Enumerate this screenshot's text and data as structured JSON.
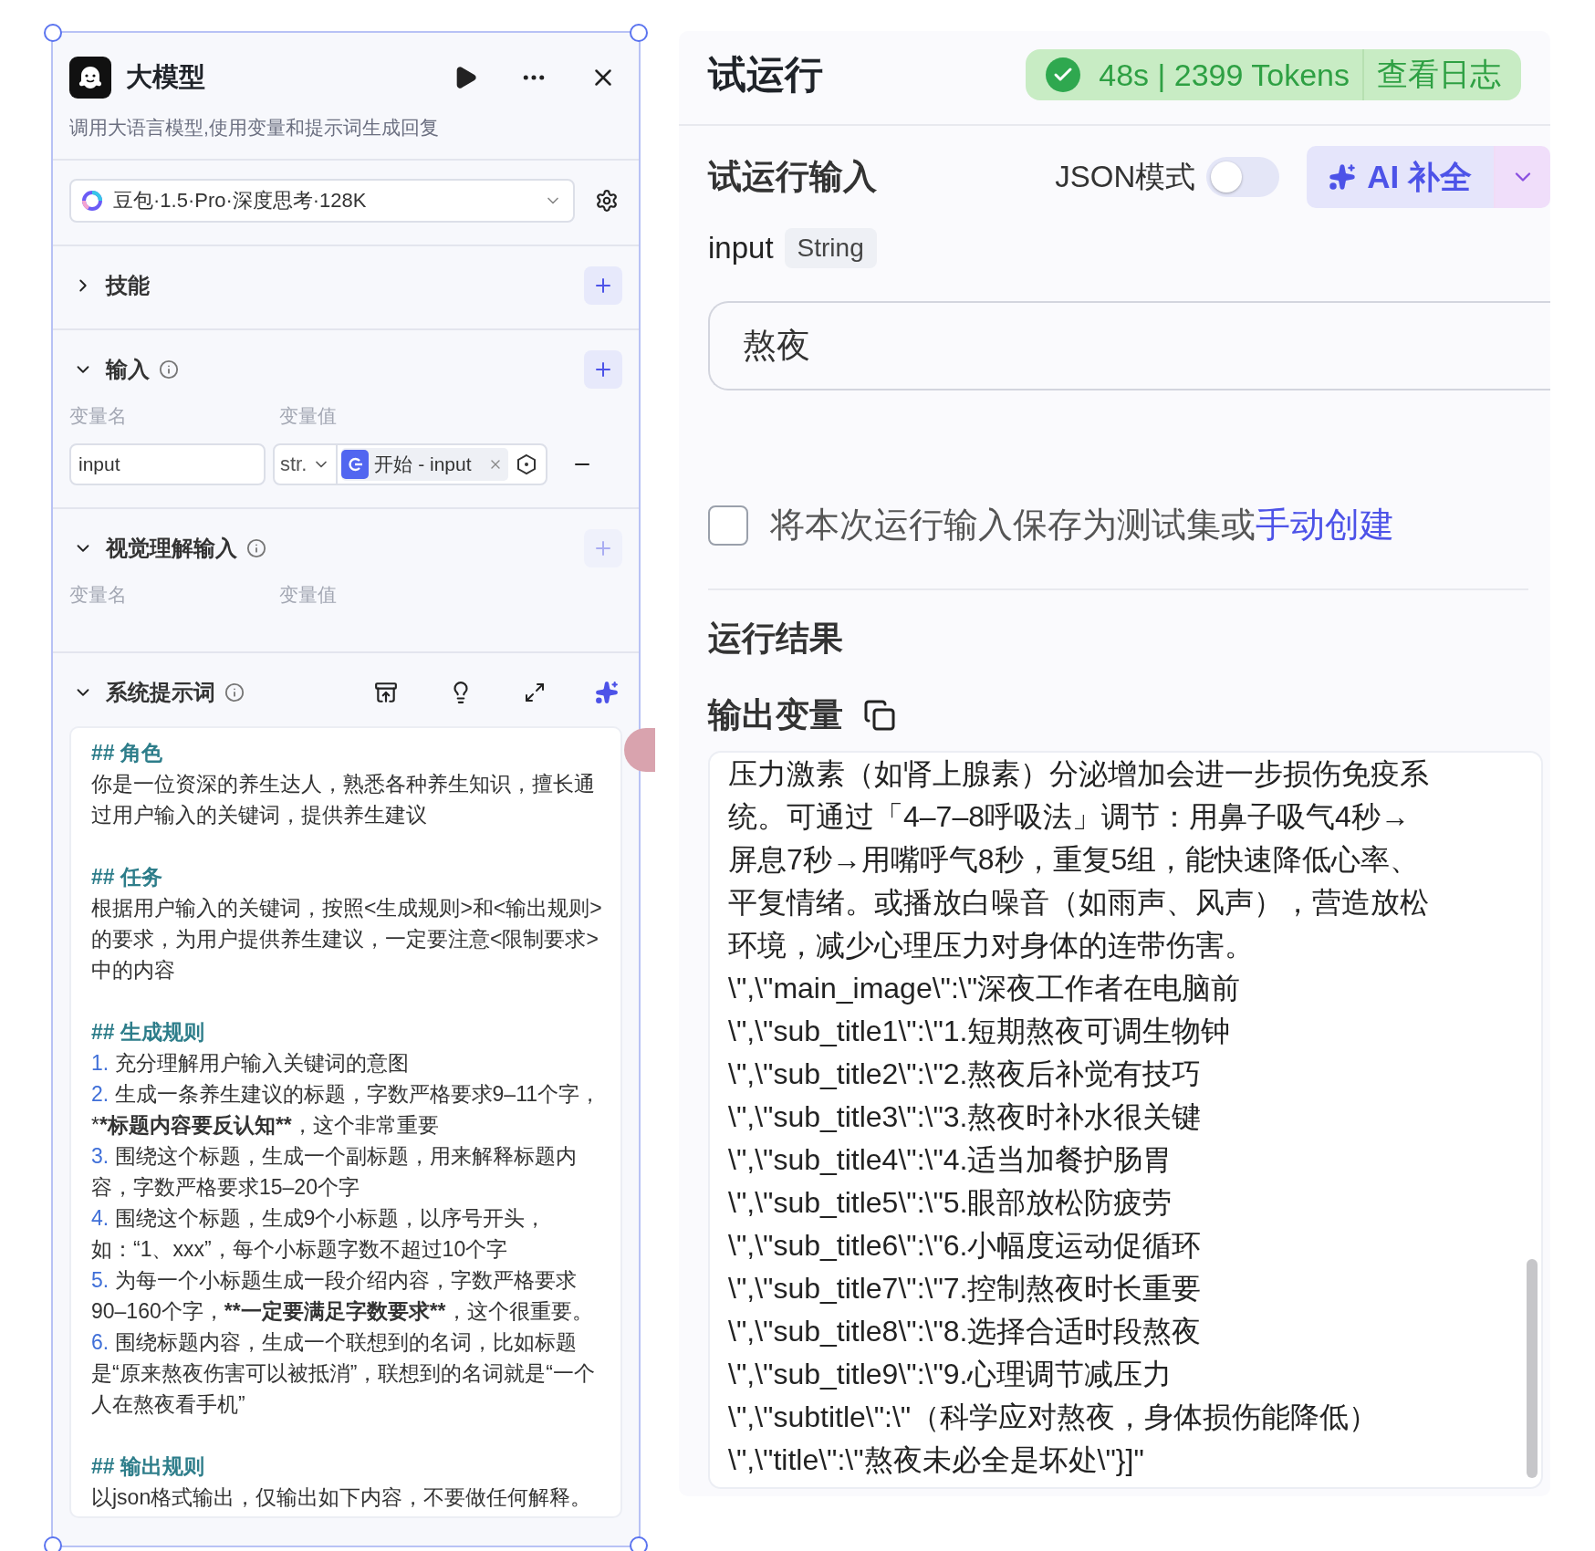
{
  "node": {
    "title": "大模型",
    "description": "调用大语言模型,使用变量和提示词生成回复",
    "model": "豆包·1.5·Pro·深度思考·128K",
    "skills": {
      "title": "技能",
      "expanded": false,
      "add_disabled": false
    },
    "inputs": {
      "title": "输入",
      "expanded": true,
      "add_disabled": false,
      "columns": [
        "变量名",
        "变量值"
      ],
      "rows": [
        {
          "name": "input",
          "type": "str.",
          "source": "开始 - input"
        }
      ]
    },
    "vision": {
      "title": "视觉理解输入",
      "expanded": true,
      "add_disabled": true,
      "columns": [
        "变量名",
        "变量值"
      ]
    },
    "system_prompt": {
      "title": "系统提示词",
      "expanded": true,
      "blocks": [
        {
          "kind": "heading",
          "text": "## 角色"
        },
        {
          "kind": "paragraph",
          "text": "你是一位资深的养生达人，熟悉各种养生知识，擅长通过用户输入的关键词，提供养生建议"
        },
        {
          "kind": "heading",
          "text": "## 任务"
        },
        {
          "kind": "paragraph",
          "text": "根据用户输入的关键词，按照<生成规则>和<输出规则>的要求，为用户提供养生建议，一定要注意<限制要求>中的内容"
        },
        {
          "kind": "heading",
          "text": "## 生成规则"
        },
        {
          "kind": "list",
          "items": [
            {
              "number": "1.",
              "segments": [
                {
                  "text": "充分理解用户输入关键词的意图",
                  "bold": false
                }
              ]
            },
            {
              "number": "2.",
              "segments": [
                {
                  "text": "生成一条养生建议的标题，字数严格要求9–11个字，*",
                  "bold": false
                },
                {
                  "text": "*标题内容要反认知**",
                  "bold": true
                },
                {
                  "text": "，这个非常重要",
                  "bold": false
                }
              ]
            },
            {
              "number": "3.",
              "segments": [
                {
                  "text": "围绕这个标题，生成一个副标题，用来解释标题内容，字数严格要求15–20个字",
                  "bold": false
                }
              ]
            },
            {
              "number": "4.",
              "segments": [
                {
                  "text": "围绕这个标题，生成9个小标题，以序号开头，如：“1、xxx”，每个小标题字数不超过10个字",
                  "bold": false
                }
              ]
            },
            {
              "number": "5.",
              "segments": [
                {
                  "text": "为每一个小标题生成一段介绍内容，字数严格要求90–160个字，",
                  "bold": false
                },
                {
                  "text": "**一定要满足字数要求**",
                  "bold": true
                },
                {
                  "text": "，这个很重要。",
                  "bold": false
                }
              ]
            },
            {
              "number": "6.",
              "segments": [
                {
                  "text": "围绕标题内容，生成一个联想到的名词，比如标题是“原来熬夜伤害可以被抵消”，联想到的名词就是“一个人在熬夜看手机”",
                  "bold": false
                }
              ]
            }
          ]
        },
        {
          "kind": "heading",
          "text": "## 输出规则"
        },
        {
          "kind": "paragraph",
          "text": "以json格式输出，仅输出如下内容，不要做任何解释。"
        }
      ]
    }
  },
  "run": {
    "title": "试运行",
    "status": {
      "success": true,
      "summary": "48s | 2399 Tokens",
      "log_link": "查看日志"
    },
    "input_section": {
      "title": "试运行输入",
      "json_mode": {
        "label": "JSON模式",
        "on": false
      },
      "ai_button": "AI 补全",
      "field": {
        "name": "input",
        "type": "String",
        "value": "熬夜"
      },
      "save": {
        "checked": false,
        "text": "将本次运行输入保存为测试集或",
        "link": "手动创建"
      }
    },
    "result": {
      "title": "运行结果",
      "output_label": "输出变量",
      "lines": [
        "压力激素（如肾上腺素）分泌增加会进一步损伤免疫系",
        "统。可通过「4–7–8呼吸法」调节：用鼻子吸气4秒→",
        "屏息7秒→用嘴呼气8秒，重复5组，能快速降低心率、",
        "平复情绪。或播放白噪音（如雨声、风声），营造放松",
        "环境，减少心理压力对身体的连带伤害。",
        "\\\",\\\"main_image\\\":\\\"深夜工作者在电脑前",
        "\\\",\\\"sub_title1\\\":\\\"1.短期熬夜可调生物钟",
        "\\\",\\\"sub_title2\\\":\\\"2.熬夜后补觉有技巧",
        "\\\",\\\"sub_title3\\\":\\\"3.熬夜时补水很关键",
        "\\\",\\\"sub_title4\\\":\\\"4.适当加餐护肠胃",
        "\\\",\\\"sub_title5\\\":\\\"5.眼部放松防疲劳",
        "\\\",\\\"sub_title6\\\":\\\"6.小幅度运动促循环",
        "\\\",\\\"sub_title7\\\":\\\"7.控制熬夜时长重要",
        "\\\",\\\"sub_title8\\\":\\\"8.选择合适时段熬夜",
        "\\\",\\\"sub_title9\\\":\\\"9.心理调节减压力",
        "\\\",\\\"subtitle\\\":\\\"（科学应对熬夜，身体损伤能降低）",
        "\\\",\\\"title\\\":\\\"熬夜未必全是坏处\\\"}]\""
      ]
    }
  }
}
